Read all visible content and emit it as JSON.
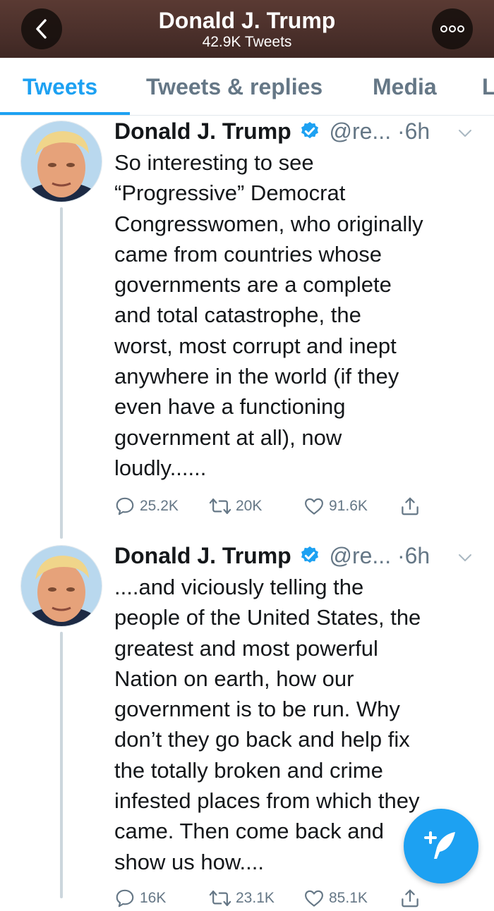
{
  "header": {
    "title": "Donald J. Trump",
    "subtitle": "42.9K Tweets",
    "back_icon": "chevron-left-icon",
    "more_icon": "ellipsis-icon"
  },
  "tabs": [
    {
      "label": "Tweets",
      "active": true
    },
    {
      "label": "Tweets & replies",
      "active": false
    },
    {
      "label": "Media",
      "active": false
    },
    {
      "label": "L",
      "active": false
    }
  ],
  "colors": {
    "accent": "#1da1f2",
    "secondary_text": "#657786",
    "header_bg": "#4a2f2a"
  },
  "tweets": [
    {
      "name": "Donald J. Trump",
      "handle": "@re...",
      "sep": "·",
      "time": "6h",
      "lines": [
        "So interesting to see",
        "“Progressive” Democrat",
        "Congresswomen, who originally",
        "came from countries whose",
        "governments are a complete",
        "and total catastrophe, the",
        "worst, most corrupt and inept",
        "anywhere in the world (if they",
        "even have a functioning",
        "government at all), now",
        "loudly......"
      ],
      "replies": "25.2K",
      "retweets": "20K",
      "likes": "91.6K"
    },
    {
      "name": "Donald J. Trump",
      "handle": "@re...",
      "sep": "·",
      "time": "6h",
      "lines": [
        "....and viciously telling the",
        "people of the United States, the",
        "greatest and most powerful",
        "Nation on earth, how our",
        "government is to be run. Why",
        "don’t they go back and help fix",
        "the totally broken and crime",
        "infested places from which they",
        "came. Then come back and",
        "show us how...."
      ],
      "replies": "16K",
      "retweets": "23.1K",
      "likes": "85.1K"
    }
  ],
  "fab": {
    "icon": "compose-tweet-icon"
  }
}
